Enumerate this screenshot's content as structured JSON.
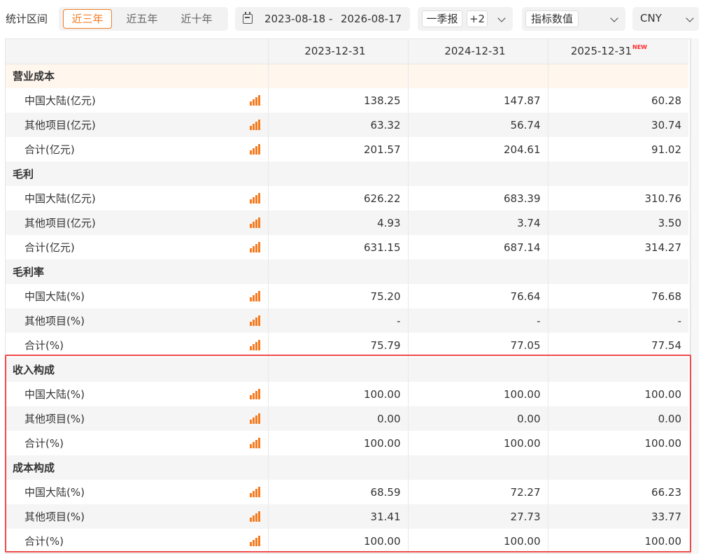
{
  "toolbar": {
    "range_label": "统计区间",
    "ranges": [
      "近三年",
      "近五年",
      "近十年"
    ],
    "date_start": "2023-08-18",
    "date_sep": "-",
    "date_end": "2026-08-17",
    "report_type": "一季报",
    "report_more": "+2",
    "metric_mode": "指标数值",
    "currency": "CNY",
    "accent_color": "#f47b20"
  },
  "table": {
    "columns": [
      "",
      "2023-12-31",
      "2024-12-31",
      "2025-12-31"
    ],
    "new_tag": "NEW",
    "sections": [
      {
        "title": "营业成本",
        "rows": [
          {
            "name": "中国大陆(亿元)",
            "values": [
              "138.25",
              "147.87",
              "60.28"
            ]
          },
          {
            "name": "其他项目(亿元)",
            "values": [
              "63.32",
              "56.74",
              "30.74"
            ]
          },
          {
            "name": "合计(亿元)",
            "values": [
              "201.57",
              "204.61",
              "91.02"
            ]
          }
        ]
      },
      {
        "title": "毛利",
        "rows": [
          {
            "name": "中国大陆(亿元)",
            "values": [
              "626.22",
              "683.39",
              "310.76"
            ]
          },
          {
            "name": "其他项目(亿元)",
            "values": [
              "4.93",
              "3.74",
              "3.50"
            ]
          },
          {
            "name": "合计(亿元)",
            "values": [
              "631.15",
              "687.14",
              "314.27"
            ]
          }
        ]
      },
      {
        "title": "毛利率",
        "rows": [
          {
            "name": "中国大陆(%)",
            "values": [
              "75.20",
              "76.64",
              "76.68"
            ]
          },
          {
            "name": "其他项目(%)",
            "values": [
              "-",
              "-",
              "-"
            ]
          },
          {
            "name": "合计(%)",
            "values": [
              "75.79",
              "77.05",
              "77.54"
            ]
          }
        ]
      },
      {
        "title": "收入构成",
        "rows": [
          {
            "name": "中国大陆(%)",
            "values": [
              "100.00",
              "100.00",
              "100.00"
            ]
          },
          {
            "name": "其他项目(%)",
            "values": [
              "0.00",
              "0.00",
              "0.00"
            ]
          },
          {
            "name": "合计(%)",
            "values": [
              "100.00",
              "100.00",
              "100.00"
            ]
          }
        ]
      },
      {
        "title": "成本构成",
        "rows": [
          {
            "name": "中国大陆(%)",
            "values": [
              "68.59",
              "72.27",
              "66.23"
            ]
          },
          {
            "name": "其他项目(%)",
            "values": [
              "31.41",
              "27.73",
              "33.77"
            ]
          },
          {
            "name": "合计(%)",
            "values": [
              "100.00",
              "100.00",
              "100.00"
            ]
          }
        ]
      }
    ],
    "highlight_color": "#ef4a4a"
  }
}
